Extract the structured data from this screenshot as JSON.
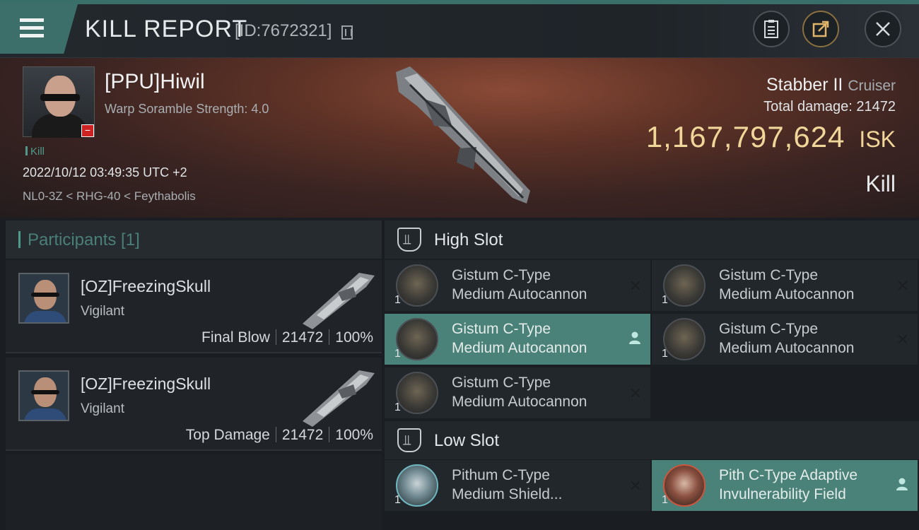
{
  "header": {
    "title": "KILL REPORT",
    "report_id": "[ID:7672321]"
  },
  "victim": {
    "name": "[PPU]Hiwil",
    "scramble": "Warp Soramble Strength: 4.0",
    "result_tag": "Kill",
    "timestamp": "2022/10/12 03:49:35 UTC +2",
    "location": "NL0-3Z < RHG-40 < Feythabolis",
    "ship": "Stabber II",
    "ship_class": "Cruiser",
    "total_damage_label": "Total damage:",
    "total_damage": "21472",
    "isk_value": "1,167,797,624",
    "isk_label": "ISK",
    "outcome": "Kill"
  },
  "participants": {
    "header": "Participants [1]",
    "items": [
      {
        "name": "[OZ]FreezingSkull",
        "ship": "Vigilant",
        "role": "Final Blow",
        "damage": "21472",
        "percent": "100%"
      },
      {
        "name": "[OZ]FreezingSkull",
        "ship": "Vigilant",
        "role": "Top Damage",
        "damage": "21472",
        "percent": "100%"
      }
    ]
  },
  "slots": {
    "high": {
      "label": "High Slot",
      "modules": [
        {
          "line1": "Gistum C-Type",
          "line2": "Medium Autocannon",
          "qty": "1",
          "status": "destroyed"
        },
        {
          "line1": "Gistum C-Type",
          "line2": "Medium Autocannon",
          "qty": "1",
          "status": "destroyed"
        },
        {
          "line1": "Gistum C-Type",
          "line2": "Medium Autocannon",
          "qty": "1",
          "status": "dropped"
        },
        {
          "line1": "Gistum C-Type",
          "line2": "Medium Autocannon",
          "qty": "1",
          "status": "destroyed"
        },
        {
          "line1": "Gistum C-Type",
          "line2": "Medium Autocannon",
          "qty": "1",
          "status": "destroyed"
        }
      ]
    },
    "low": {
      "label": "Low Slot",
      "modules": [
        {
          "line1": "Pithum C-Type",
          "line2": "Medium Shield...",
          "qty": "1",
          "status": "destroyed"
        },
        {
          "line1": "Pith C-Type Adaptive",
          "line2": "Invulnerability Field",
          "qty": "1",
          "status": "dropped"
        }
      ]
    }
  },
  "icons": {
    "destroyed": "✕",
    "dropped": "👤"
  },
  "colors": {
    "accent": "#4a8178",
    "isk": "#f1d69a"
  }
}
